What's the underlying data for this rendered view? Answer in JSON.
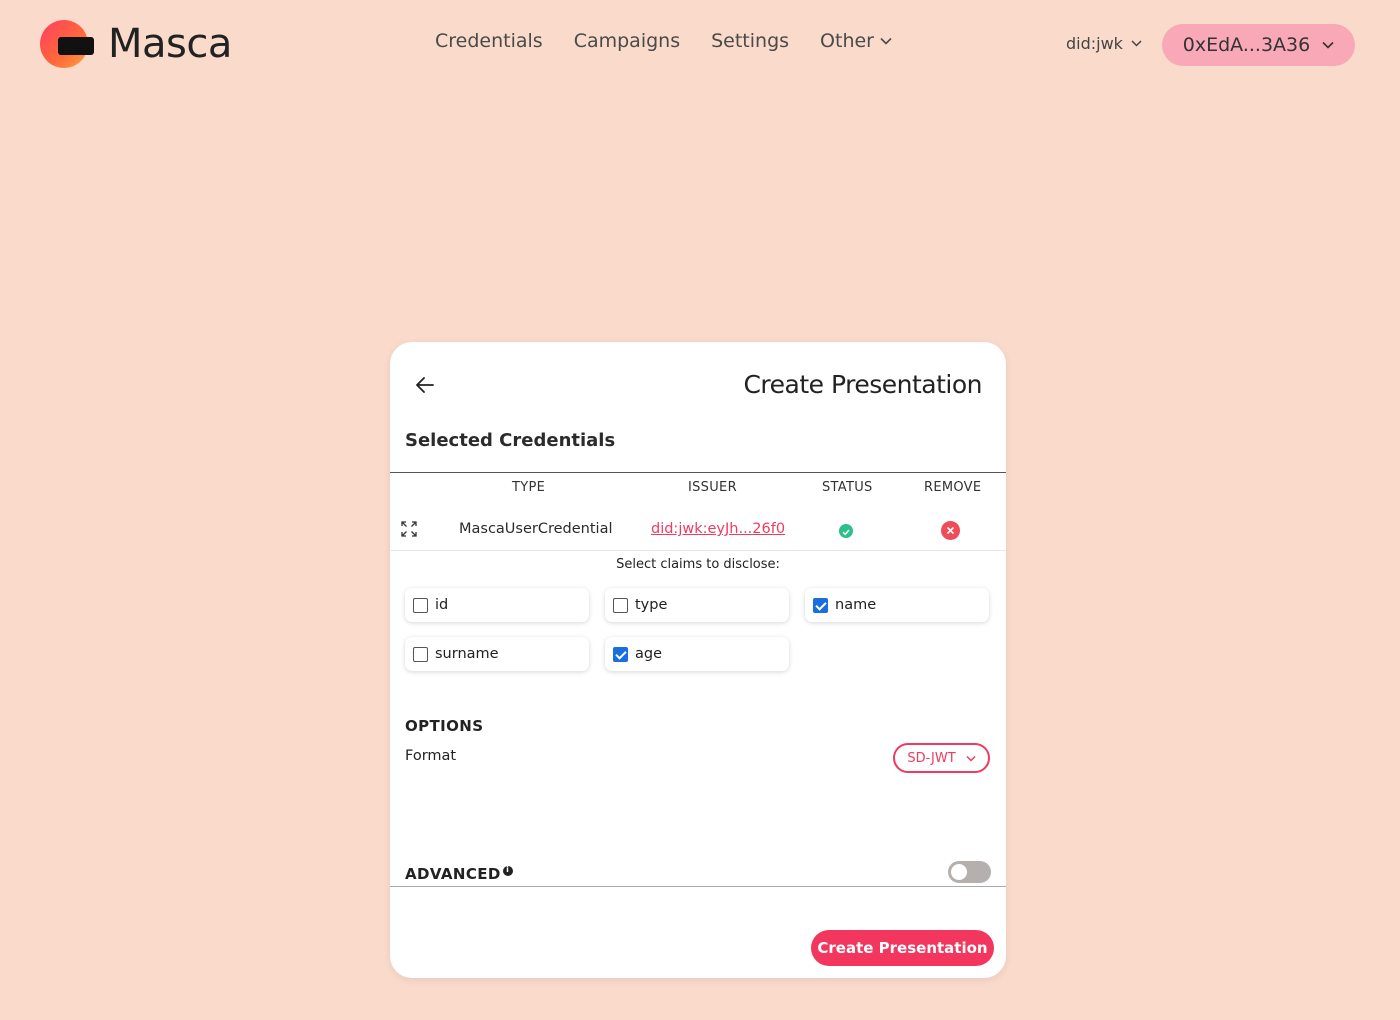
{
  "header": {
    "logo_text": "Masca",
    "nav": [
      {
        "label": "Credentials"
      },
      {
        "label": "Campaigns"
      },
      {
        "label": "Settings"
      },
      {
        "label": "Other",
        "dropdown": true
      }
    ],
    "did_method": "did:jwk",
    "wallet_address": "0xEdA...3A36"
  },
  "card": {
    "title": "Create Presentation",
    "section_title": "Selected Credentials",
    "table": {
      "headers": [
        "TYPE",
        "ISSUER",
        "STATUS",
        "REMOVE"
      ],
      "rows": [
        {
          "type": "MascaUserCredential",
          "issuer": "did:jwk:eyJh...26f0",
          "status": "valid"
        }
      ]
    },
    "claims_label": "Select claims to disclose:",
    "claims": [
      {
        "label": "id",
        "checked": false
      },
      {
        "label": "type",
        "checked": false
      },
      {
        "label": "name",
        "checked": true
      },
      {
        "label": "surname",
        "checked": false
      },
      {
        "label": "age",
        "checked": true
      }
    ],
    "options_title": "OPTIONS",
    "format_label": "Format",
    "format_value": "SD-JWT",
    "advanced_title": "ADVANCED",
    "advanced_enabled": false,
    "create_button": "Create Presentation"
  },
  "colors": {
    "background": "#fadacb",
    "accent": "#ef3b5f",
    "wallet_button": "#f9a8b8",
    "status_ok": "#2cc08b",
    "remove": "#ef4c57",
    "checkbox": "#1a6fe0"
  }
}
